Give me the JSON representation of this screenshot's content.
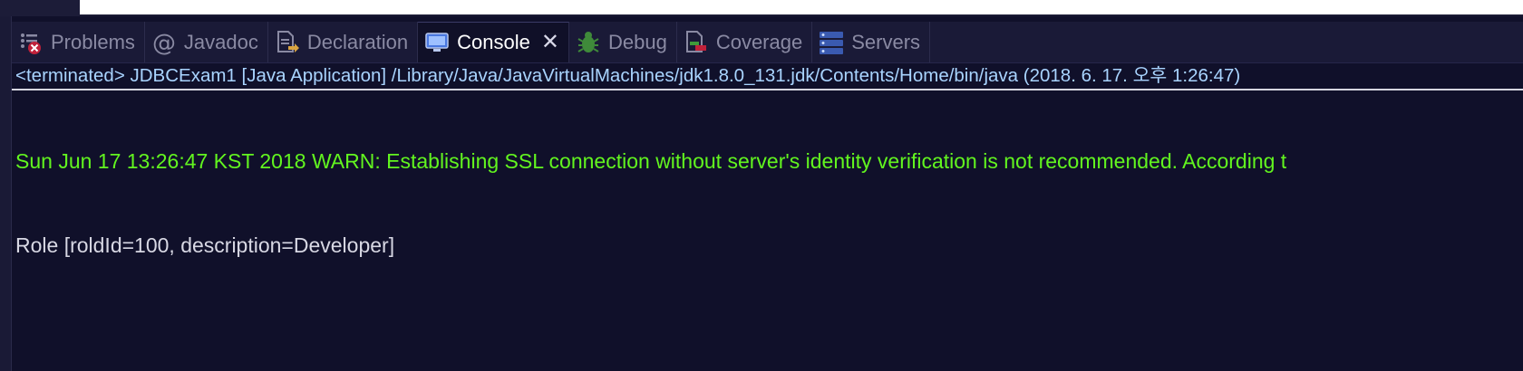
{
  "tabs": [
    {
      "label": "Problems",
      "icon": "problems-icon",
      "active": false
    },
    {
      "label": "Javadoc",
      "icon": "javadoc-icon",
      "active": false
    },
    {
      "label": "Declaration",
      "icon": "declaration-icon",
      "active": false
    },
    {
      "label": "Console",
      "icon": "console-icon",
      "active": true,
      "close": "✕"
    },
    {
      "label": "Debug",
      "icon": "debug-icon",
      "active": false
    },
    {
      "label": "Coverage",
      "icon": "coverage-icon",
      "active": false
    },
    {
      "label": "Servers",
      "icon": "servers-icon",
      "active": false
    }
  ],
  "console": {
    "status": "<terminated> JDBCExam1 [Java Application] /Library/Java/JavaVirtualMachines/jdk1.8.0_131.jdk/Contents/Home/bin/java (2018. 6. 17. 오후 1:26:47)",
    "lines": [
      "Sun Jun 17 13:26:47 KST 2018 WARN: Establishing SSL connection without server's identity verification is not recommended. According t",
      "Role [roldId=100, description=Developer]"
    ]
  },
  "colors": {
    "background": "#10102a",
    "warn_text": "#62f51f",
    "status_text": "#a9d4ff"
  }
}
